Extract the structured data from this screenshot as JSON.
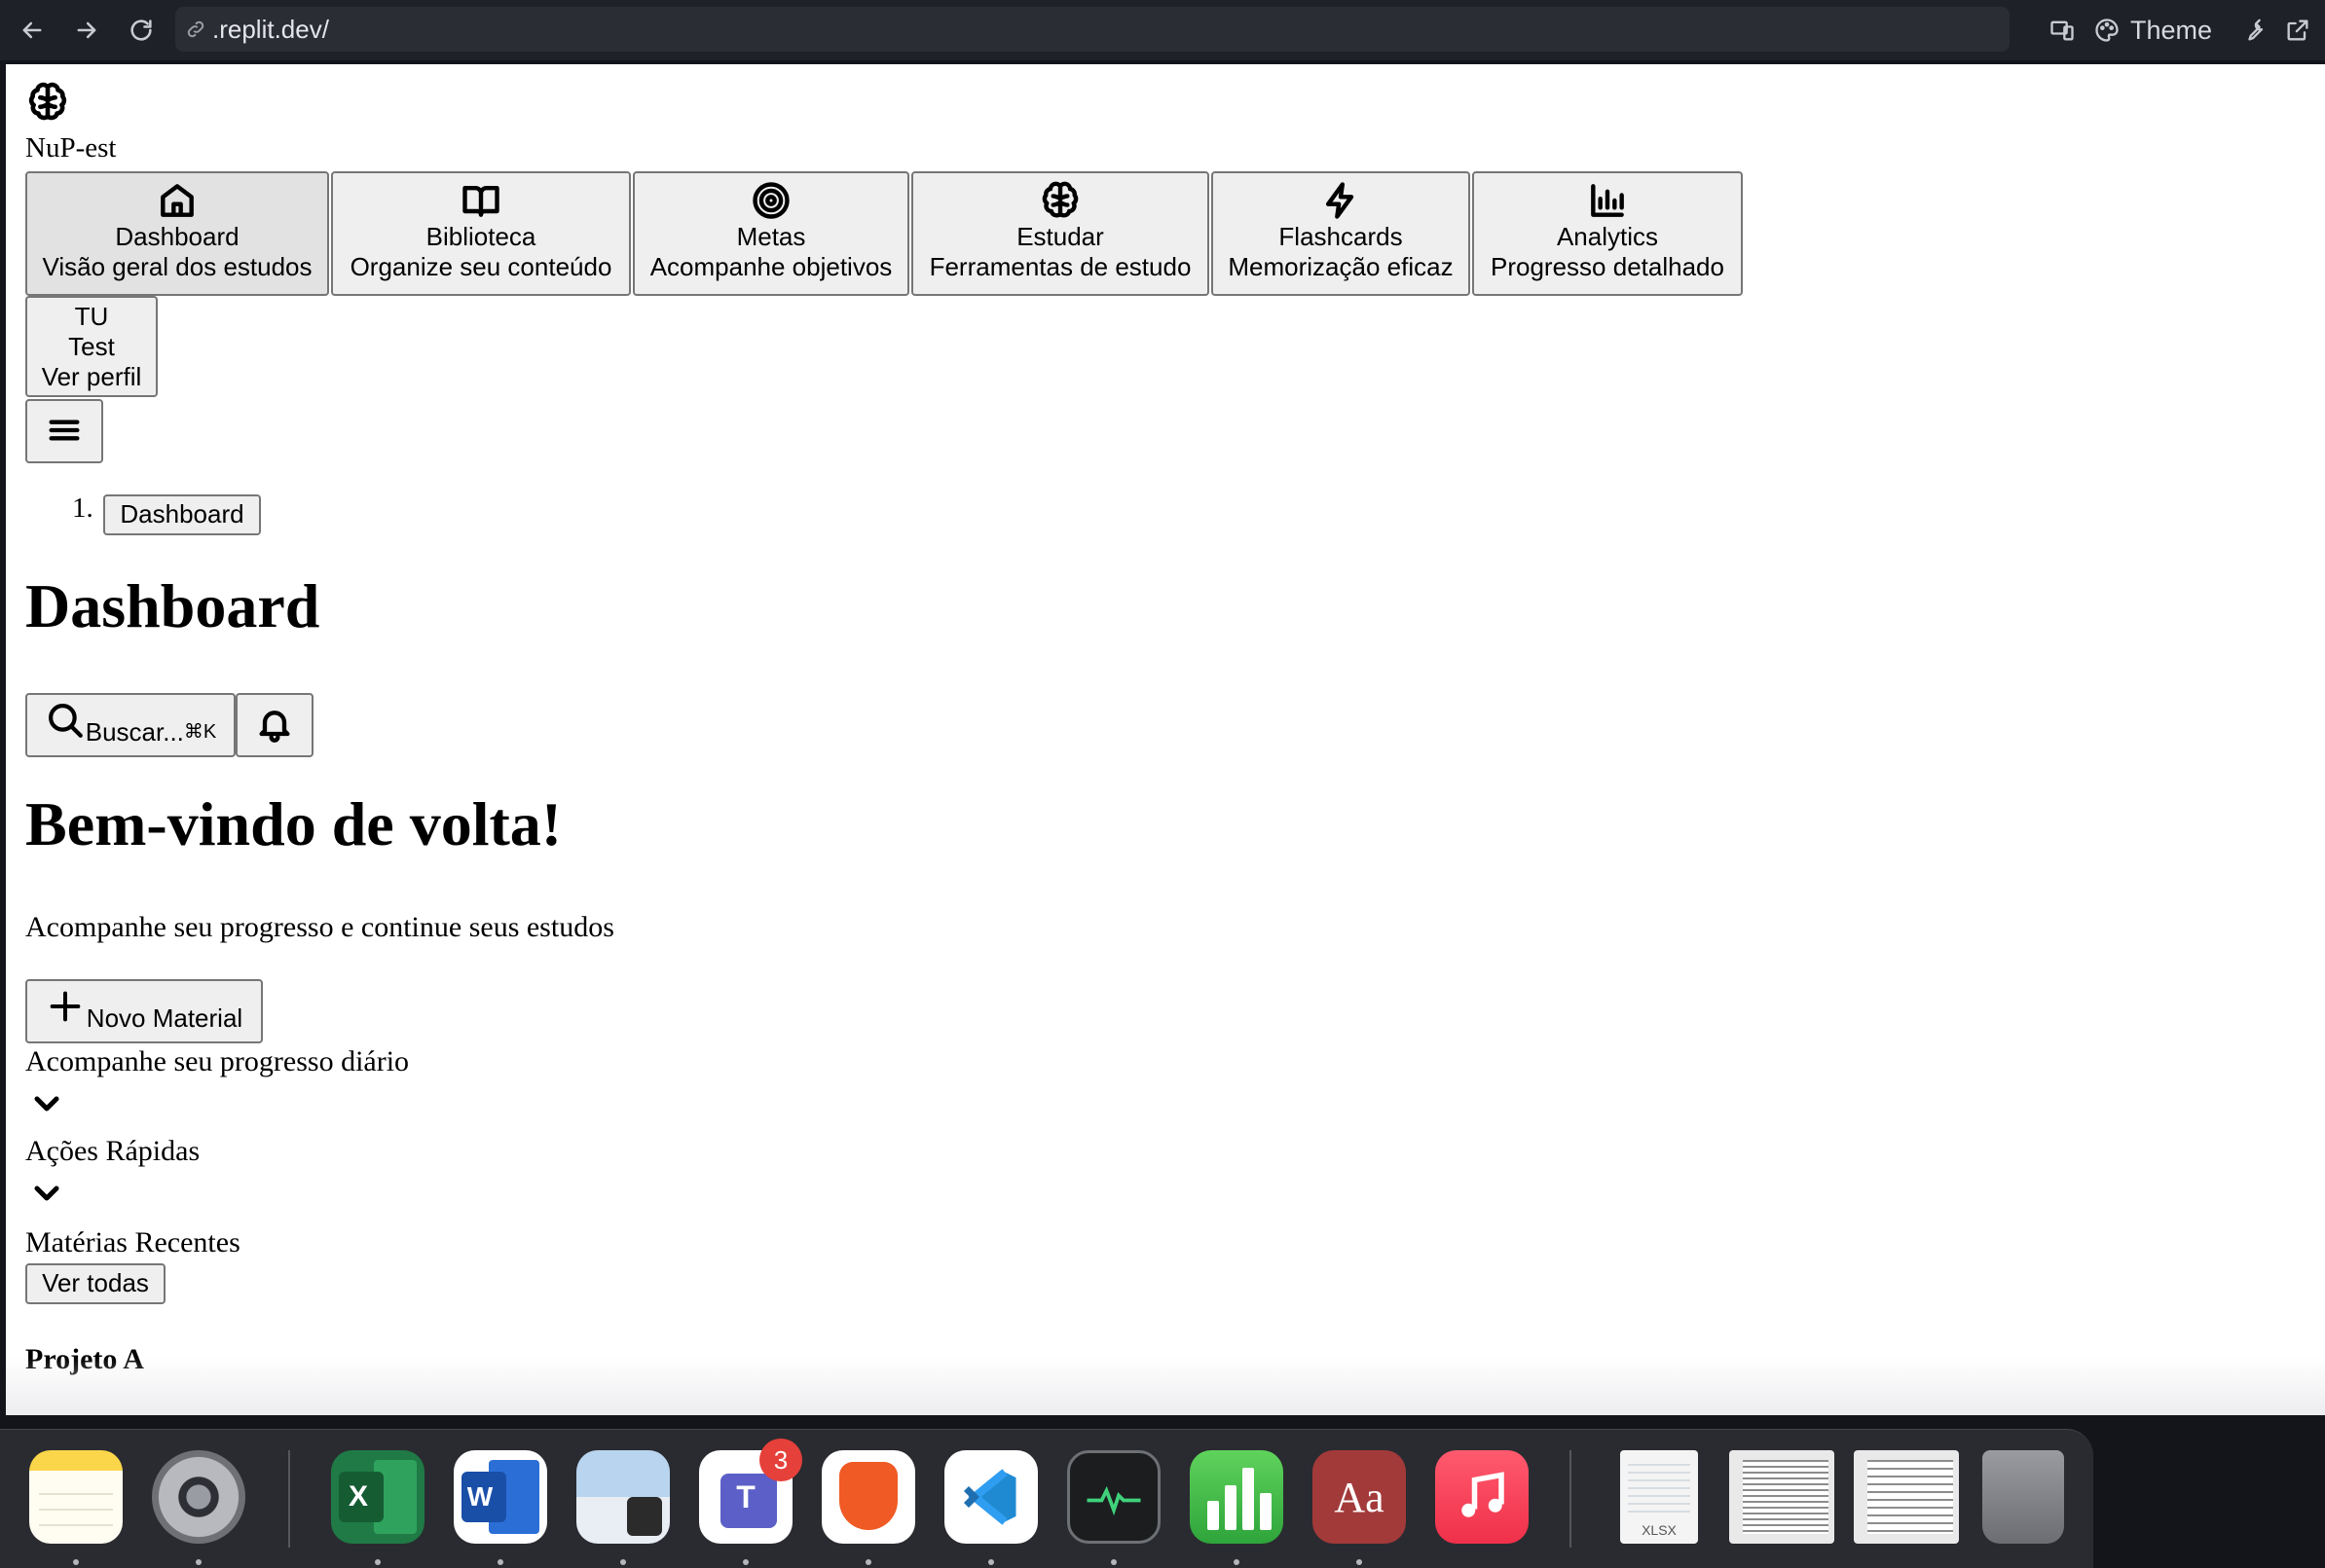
{
  "browser": {
    "url": ".replit.dev/",
    "theme_label": "Theme"
  },
  "app": {
    "brand": "NuP-est",
    "nav": [
      {
        "label": "Dashboard",
        "desc": "Visão geral dos estudos",
        "icon": "home-icon"
      },
      {
        "label": "Biblioteca",
        "desc": "Organize seu conteúdo",
        "icon": "book-open-icon"
      },
      {
        "label": "Metas",
        "desc": "Acompanhe objetivos",
        "icon": "target-icon"
      },
      {
        "label": "Estudar",
        "desc": "Ferramentas de estudo",
        "icon": "brain-icon"
      },
      {
        "label": "Flashcards",
        "desc": "Memorização eficaz",
        "icon": "lightning-icon"
      },
      {
        "label": "Analytics",
        "desc": "Progresso detalhado",
        "icon": "bar-chart-icon"
      }
    ],
    "user": {
      "initials": "TU",
      "name": "Test",
      "action": "Ver perfil"
    },
    "breadcrumb": {
      "marker": "1.",
      "item": "Dashboard"
    },
    "page_title": "Dashboard",
    "search": {
      "label": "Buscar...",
      "shortcut": "⌘K"
    },
    "welcome": "Bem-vindo de volta!",
    "subtitle": "Acompanhe seu progresso e continue seus estudos",
    "new_material": "Novo Material",
    "progress_section": "Acompanhe seu progresso diário",
    "quick_actions": "Ações Rápidas",
    "recent_title": "Matérias Recentes",
    "view_all": "Ver todas",
    "project": "Projeto A"
  },
  "dock": {
    "items": [
      "Notes",
      "System Settings",
      "Excel",
      "Word",
      "Preview",
      "Teams",
      "Brave",
      "VS Code",
      "Activity Monitor",
      "Numbers",
      "Dictionary",
      "Music",
      "XLSX file",
      "Window 1",
      "Window 2",
      "Trash"
    ],
    "teams_badge": "3",
    "excel_glyph": "X",
    "word_glyph": "W",
    "teams_glyph": "T",
    "dictionary_glyph": "Aa",
    "xlsx_label": "XLSX"
  }
}
